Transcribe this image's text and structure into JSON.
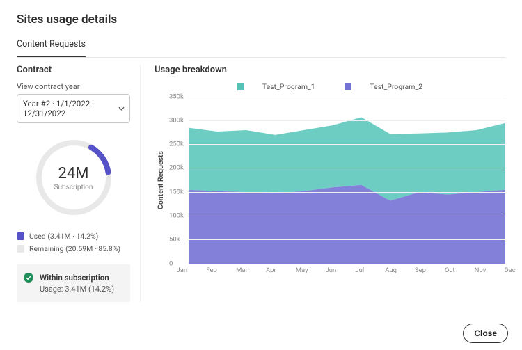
{
  "title": "Sites usage details",
  "tab_content_requests": "Content Requests",
  "left": {
    "section": "Contract",
    "year_label": "View contract year",
    "year_value": "Year #2  ·  1/1/2022 - 12/31/2022",
    "donut_value": "24M",
    "donut_sub": "Subscription",
    "legend_used": "Used (3.41M · 14.2%)",
    "legend_remaining": "Remaining (20.59M · 85.8%)",
    "status_title": "Within subscription",
    "status_sub": "Usage: 3.41M (14.2%)"
  },
  "right": {
    "section": "Usage breakdown",
    "legend1": "Test_Program_1",
    "legend2": "Test_Program_2",
    "ylabel": "Content Requests"
  },
  "colors": {
    "series1": "#55c4b8",
    "series2": "#7472d4",
    "used_swatch": "#5452c6",
    "remaining_swatch": "#e8e8e8",
    "status_ok": "#1e8f5a"
  },
  "close": "Close",
  "chart_data": {
    "type": "area",
    "stacked": true,
    "categories": [
      "Jan",
      "Feb",
      "Mar",
      "Apr",
      "May",
      "Jun",
      "Jul",
      "Aug",
      "Sep",
      "Oct",
      "Nov",
      "Dec"
    ],
    "series": [
      {
        "name": "Test_Program_2",
        "color": "#7472d4",
        "values": [
          155000,
          152000,
          150000,
          148000,
          152000,
          160000,
          165000,
          132000,
          150000,
          145000,
          150000,
          155000
        ]
      },
      {
        "name": "Test_Program_1",
        "color": "#55c4b8",
        "values": [
          130000,
          125000,
          130000,
          122000,
          128000,
          130000,
          142000,
          140000,
          123000,
          130000,
          130000,
          140000
        ]
      }
    ],
    "ylabel": "Content Requests",
    "xlabel": "",
    "ylim": [
      0,
      350000
    ],
    "yticks": [
      0,
      50000,
      100000,
      150000,
      200000,
      250000,
      300000,
      350000
    ],
    "ytick_labels": [
      "0",
      "50k",
      "100k",
      "150k",
      "200k",
      "250k",
      "300k",
      "350k"
    ],
    "grid": true
  },
  "donut": {
    "used_pct": 14.2
  }
}
